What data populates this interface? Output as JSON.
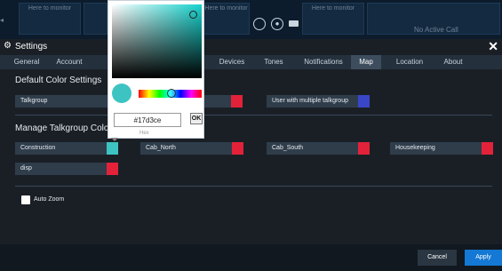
{
  "topbar": {
    "slot_text": "Here to monitor",
    "no_active_call": "No Active Call",
    "left_icon": "chevron-left-icon",
    "controls": [
      {
        "icon": "record-icon"
      },
      {
        "icon": "mic-icon"
      },
      {
        "icon": "camera-icon"
      }
    ]
  },
  "settings": {
    "title": "Settings",
    "gear_icon": "gear-icon",
    "close_icon": "close-icon",
    "close_symbol": "✕",
    "tabs": [
      {
        "label": "General"
      },
      {
        "label": "Account"
      },
      {
        "label": "Devices"
      },
      {
        "label": "Tones"
      },
      {
        "label": "Notifications"
      },
      {
        "label": "Map",
        "active": true
      },
      {
        "label": "Location"
      },
      {
        "label": "About"
      }
    ],
    "default_colors_heading": "Default Color Settings",
    "default_rows": [
      {
        "label": "Talkgroup",
        "color": "#e3223a"
      },
      {
        "label": "User with multiple talkgroup",
        "color": "#3a46c8"
      }
    ],
    "manage_heading": "Manage Talkgroup Colors",
    "talkgroups": [
      {
        "label": "Construction",
        "color": "#3dc3c2"
      },
      {
        "label": "Cab_North",
        "color": "#e3223a"
      },
      {
        "label": "Cab_South",
        "color": "#e3223a"
      },
      {
        "label": "Housekeeping",
        "color": "#e3223a"
      },
      {
        "label": "disp",
        "color": "#e3223a"
      }
    ],
    "auto_zoom_label": "Auto Zoom",
    "auto_zoom_checked": false,
    "cancel_label": "Cancel",
    "apply_label": "Apply",
    "apply_color": "#1478d4"
  },
  "picker": {
    "hex_value": "#17d3ce",
    "ok_label": "OK",
    "hex_caption": "Hex",
    "preview_color": "#3dc3c2"
  }
}
